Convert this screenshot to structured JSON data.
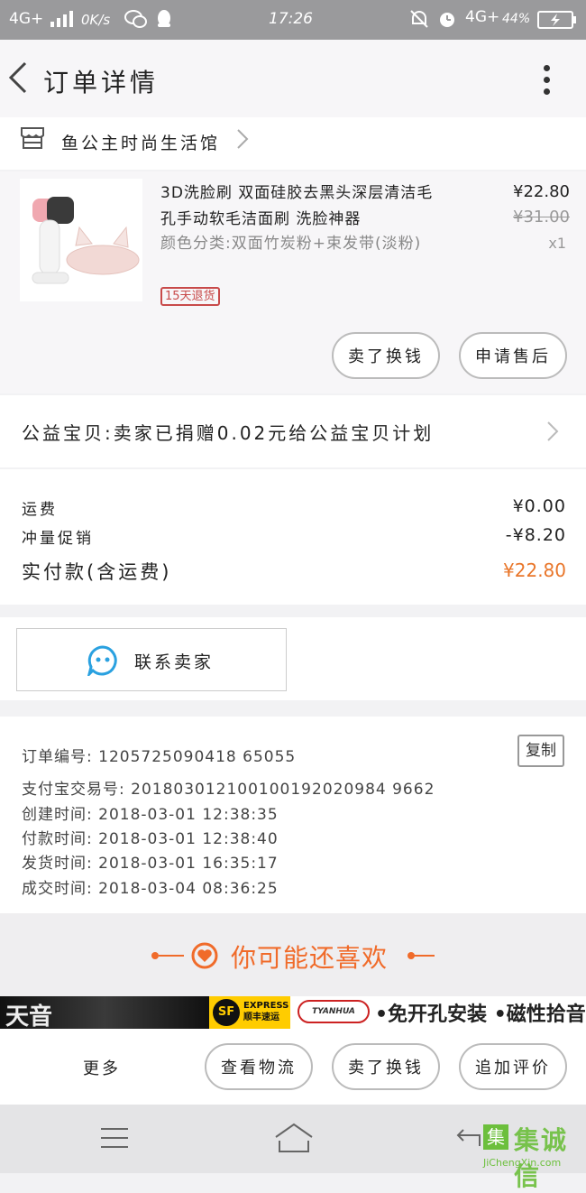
{
  "status_bar": {
    "network_left": "4G+",
    "speed": "0K/s",
    "time": "17:26",
    "network_right": "4G+",
    "battery": "44%"
  },
  "header": {
    "title": "订单详情"
  },
  "shop": {
    "name": "鱼公主时尚生活馆"
  },
  "product": {
    "title": "3D洗脸刷 双面硅胶去黑头深层清洁毛孔手动软毛洁面刷 洗脸神器",
    "sku": "颜色分类:双面竹炭粉+束发带(淡粉)",
    "badge": "15天退货",
    "price": "¥22.80",
    "original_price": "¥31.00",
    "quantity": "x1",
    "buttons": {
      "resell": "卖了换钱",
      "after_sale": "申请售后"
    }
  },
  "charity": {
    "text": "公益宝贝:卖家已捐赠0.02元给公益宝贝计划"
  },
  "fees": {
    "shipping_label": "运费",
    "shipping_value": "¥0.00",
    "promo_label": "冲量促销",
    "promo_value": "-¥8.20",
    "total_label": "实付款(含运费)",
    "total_value": "¥22.80"
  },
  "contact": {
    "label": "联系卖家"
  },
  "order_info": {
    "copy_label": "复制",
    "order_no": "订单编号: 1205725090418 65055",
    "alipay_no": "支付宝交易号: 201803012100100192020984 9662",
    "created": "创建时间: 2018-03-01  12:38:35",
    "paid": "付款时间: 2018-03-01  12:38:40",
    "shipped": "发货时间: 2018-03-01  16:35:17",
    "completed": "成交时间: 2018-03-04  08:36:25"
  },
  "recommend": {
    "title": "你可能还喜欢"
  },
  "banner": {
    "left_text": "天音",
    "sf_main": "SF",
    "sf_sub": "EXPRESS 顺丰速运",
    "brand": "TYANHUA",
    "slogan": "•免开孔安装 •磁性拾音"
  },
  "action_bar": {
    "more": "更多",
    "logistics": "查看物流",
    "resell": "卖了换钱",
    "add_review": "追加评价"
  },
  "watermark": {
    "main": "集诚信",
    "box": "集",
    "url": "JiChengXin.com"
  },
  "colors": {
    "accent": "#f06b2a",
    "total": "#e9762a",
    "badge": "#c84a4a",
    "chat": "#2aa1e0"
  }
}
